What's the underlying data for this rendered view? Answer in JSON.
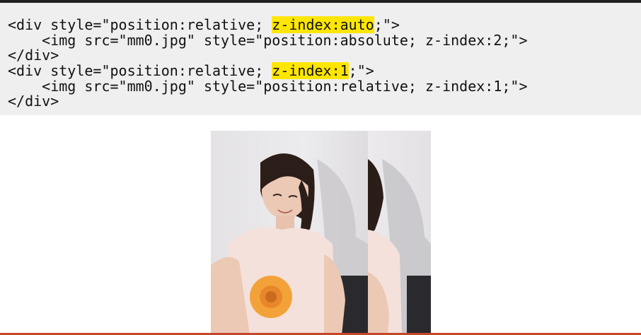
{
  "code_lines": [
    {
      "before": "<div style=\"position:relative; ",
      "highlight": "z-index:auto",
      "after": ";\">"
    },
    {
      "text": "    <img src=\"mm0.jpg\" style=\"position:absolute; z-index:2;\">"
    },
    {
      "text": "</div>"
    },
    {
      "before": "<div style=\"position:relative; ",
      "highlight": "z-index:1",
      "after": ";\">"
    },
    {
      "text": "    <img src=\"mm0.jpg\" style=\"position:relative; z-index:1;\">"
    },
    {
      "text": "</div>"
    }
  ],
  "colors": {
    "highlight": "#ffe600",
    "panel_background": "#f0eff0",
    "accent_line": "#c7452a"
  },
  "images": {
    "main_photo": "mm0.jpg",
    "cropped_photo": "mm0.jpg"
  }
}
